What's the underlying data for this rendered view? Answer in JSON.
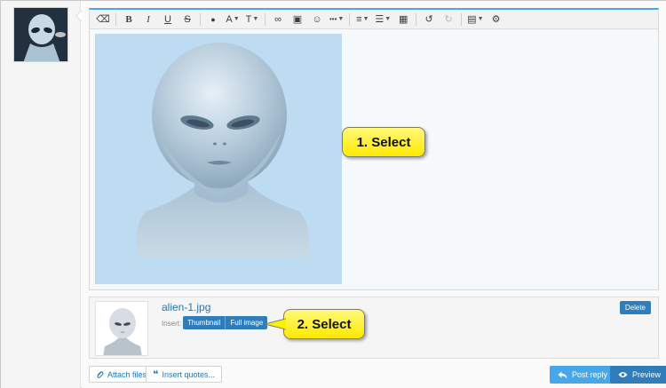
{
  "toolbar": {
    "items": [
      {
        "name": "clear-format-icon",
        "glyph": "⌫"
      },
      {
        "name": "bold-icon",
        "glyph": "B"
      },
      {
        "name": "italic-icon",
        "glyph": "I"
      },
      {
        "name": "underline-icon",
        "glyph": "U"
      },
      {
        "name": "strikethrough-icon",
        "glyph": "S"
      },
      {
        "name": "text-color-icon",
        "glyph": "●"
      },
      {
        "name": "font-family-icon",
        "glyph": "A"
      },
      {
        "name": "font-size-icon",
        "glyph": "T"
      },
      {
        "name": "link-icon",
        "glyph": "∞"
      },
      {
        "name": "image-icon",
        "glyph": "▣"
      },
      {
        "name": "smilie-icon",
        "glyph": "☺"
      },
      {
        "name": "more-options-icon",
        "glyph": "•••"
      },
      {
        "name": "align-icon",
        "glyph": "≡"
      },
      {
        "name": "list-icon",
        "glyph": "☰"
      },
      {
        "name": "table-icon",
        "glyph": "▦"
      },
      {
        "name": "undo-icon",
        "glyph": "↺"
      },
      {
        "name": "redo-icon",
        "glyph": "↻"
      },
      {
        "name": "drafts-icon",
        "glyph": "▤"
      },
      {
        "name": "settings-icon",
        "glyph": "⚙"
      }
    ]
  },
  "callouts": {
    "first": "1. Select",
    "second": "2. Select"
  },
  "attachment": {
    "filename": "alien-1.jpg",
    "insert_label": "Insert:",
    "thumbnail_label": "Thumbnail",
    "full_image_label": "Full image",
    "delete_label": "Delete"
  },
  "footer": {
    "attach_files_label": "Attach files",
    "insert_quotes_label": "Insert quotes...",
    "post_reply_label": "Post reply",
    "preview_label": "Preview"
  },
  "colors": {
    "accent": "#2f7dbb",
    "post_reply": "#47a7eb",
    "callout_fill": "#fff200",
    "image_bg": "#bddcf1"
  }
}
